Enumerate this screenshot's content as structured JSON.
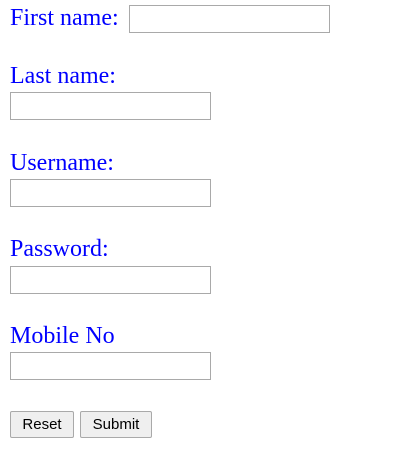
{
  "form": {
    "first_name": {
      "label": "First name:",
      "value": "",
      "placeholder": ""
    },
    "last_name": {
      "label": "Last name:",
      "value": "",
      "placeholder": ""
    },
    "username": {
      "label": "Username:",
      "value": "",
      "placeholder": ""
    },
    "password": {
      "label": "Password:",
      "value": "",
      "placeholder": ""
    },
    "mobile_no": {
      "label": "Mobile No",
      "value": "",
      "placeholder": ""
    },
    "reset_label": "Reset",
    "submit_label": "Submit"
  },
  "colors": {
    "label_text": "#0000ff",
    "input_border": "#a9a9a9",
    "button_background": "#efefef"
  }
}
